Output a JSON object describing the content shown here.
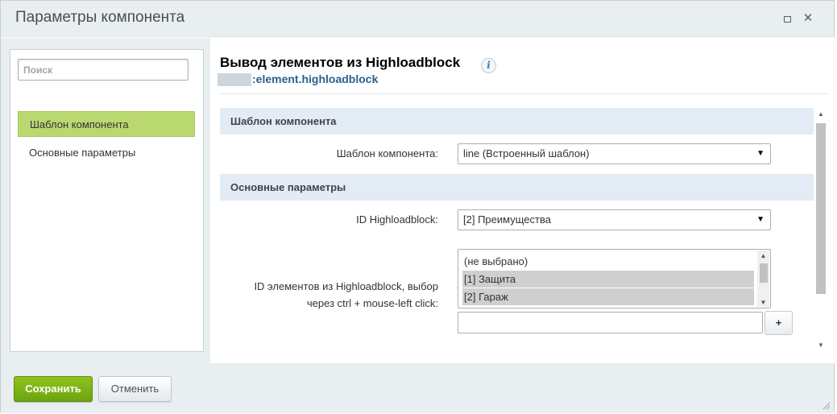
{
  "dialog": {
    "title": "Параметры компонента"
  },
  "sidebar": {
    "search_placeholder": "Поиск",
    "items": [
      {
        "label": "Шаблон компонента",
        "active": true
      },
      {
        "label": "Основные параметры",
        "active": false
      }
    ]
  },
  "component": {
    "title": "Вывод элементов из Highloadblock",
    "info_icon": "i",
    "code": ":element.highloadblock"
  },
  "sections": [
    {
      "title": "Шаблон компонента",
      "fields": [
        {
          "label": "Шаблон компонента:",
          "value": "line (Встроенный шаблон)"
        }
      ]
    },
    {
      "title": "Основные параметры",
      "fields": [
        {
          "label": "ID Highloadblock:",
          "value": "[2] Преимущества"
        },
        {
          "label_line1": "ID элементов из Highloadblock, выбор",
          "label_line2": "через ctrl + mouse-left click:",
          "options": [
            {
              "text": "(не выбрано)",
              "selected": false
            },
            {
              "text": "[1] Защита",
              "selected": true
            },
            {
              "text": "[2] Гараж",
              "selected": true
            }
          ],
          "add_value": "",
          "add_button": "+"
        }
      ]
    }
  ],
  "footer": {
    "save_label": "Сохранить",
    "cancel_label": "Отменить"
  },
  "colors": {
    "accent_green": "#7ab317",
    "active_nav": "#bad870",
    "section_bg": "#e3ecf4",
    "link_blue": "#2a5f8f"
  }
}
